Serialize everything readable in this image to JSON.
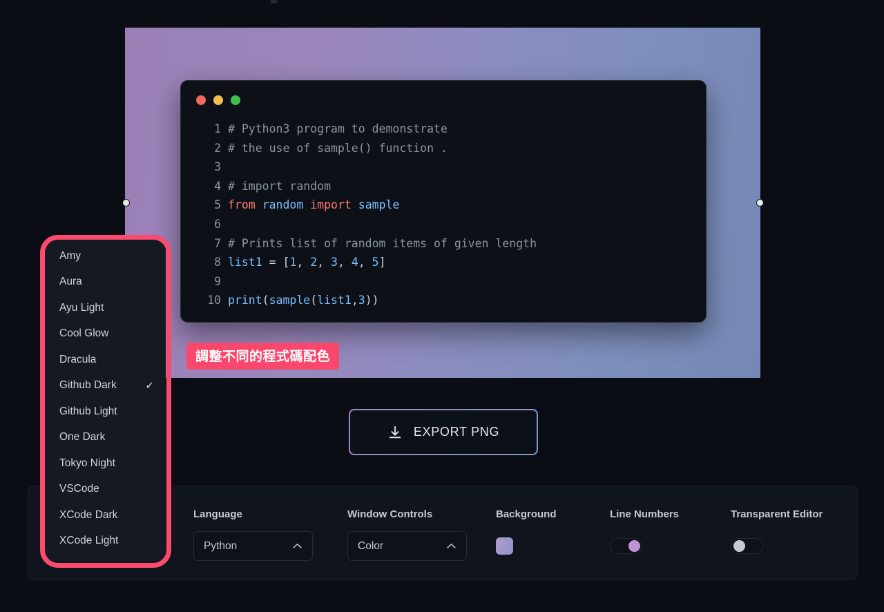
{
  "preview": {
    "background_gradient_from": "#9a7fb5",
    "background_gradient_to": "#7588b5",
    "resize_handle_left": "resize-handle-left",
    "resize_handle_right": "resize-handle-right"
  },
  "code_window": {
    "traffic_lights": [
      {
        "name": "close",
        "color": "#ec6a5e"
      },
      {
        "name": "minimize",
        "color": "#f1be4f"
      },
      {
        "name": "maximize",
        "color": "#3ec14e"
      }
    ],
    "line_numbers": "1\n2\n3\n4\n5\n6\n7\n8\n9\n10",
    "lines": [
      {
        "n": "1",
        "text": "# Python3 program to demonstrate"
      },
      {
        "n": "2",
        "text": "# the use of sample() function ."
      },
      {
        "n": "3",
        "text": ""
      },
      {
        "n": "4",
        "text": "# import random"
      },
      {
        "n": "5",
        "text": "from random import sample"
      },
      {
        "n": "6",
        "text": ""
      },
      {
        "n": "7",
        "text": "# Prints list of random items of given length"
      },
      {
        "n": "8",
        "text": "list1 = [1, 2, 3, 4, 5]"
      },
      {
        "n": "9",
        "text": ""
      },
      {
        "n": "10",
        "text": "print(sample(list1,3))"
      }
    ],
    "colors": {
      "comment": "#8b949e",
      "keyword": "#ff7b72",
      "identifier": "#79c0ff",
      "text": "#c9d1d9",
      "background": "#0d1117"
    }
  },
  "annotation": {
    "chip_text": "調整不同的程式碼配色",
    "chip_color": "#f9476d",
    "outline_color": "#fa4a6e"
  },
  "export": {
    "label": "EXPORT PNG",
    "icon": "download-icon"
  },
  "settings": {
    "language": {
      "label": "Language",
      "value": "Python",
      "icon": "chevron-up-icon"
    },
    "window_controls": {
      "label": "Window Controls",
      "value": "Color",
      "icon": "chevron-up-icon"
    },
    "background": {
      "label": "Background",
      "swatch_from": "#b39ad2",
      "swatch_to": "#8f93c6"
    },
    "line_numbers": {
      "label": "Line Numbers",
      "state": "on",
      "knob_color": "#c093d8"
    },
    "transparent_editor": {
      "label": "Transparent Editor",
      "state": "off",
      "knob_color": "#c6c9ce"
    }
  },
  "theme_dropdown": {
    "selected": "Github Dark",
    "check_glyph": "✓",
    "items": [
      {
        "label": "Amy",
        "selected": false
      },
      {
        "label": "Aura",
        "selected": false
      },
      {
        "label": "Ayu Light",
        "selected": false
      },
      {
        "label": "Cool Glow",
        "selected": false
      },
      {
        "label": "Dracula",
        "selected": false
      },
      {
        "label": "Github Dark",
        "selected": true
      },
      {
        "label": "Github Light",
        "selected": false
      },
      {
        "label": "One Dark",
        "selected": false
      },
      {
        "label": "Tokyo Night",
        "selected": false
      },
      {
        "label": "VSCode",
        "selected": false
      },
      {
        "label": "XCode Dark",
        "selected": false
      },
      {
        "label": "XCode Light",
        "selected": false
      }
    ]
  }
}
